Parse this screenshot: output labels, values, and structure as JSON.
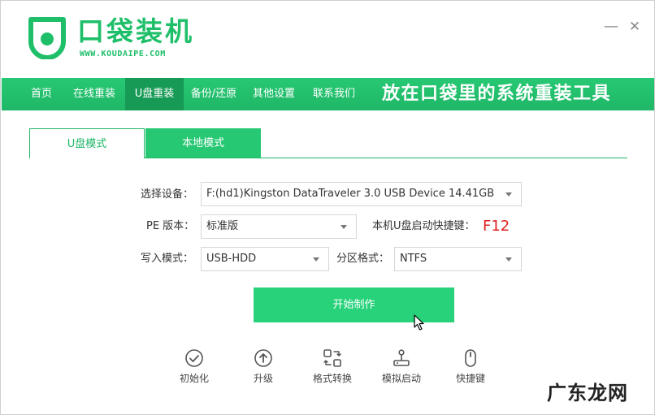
{
  "app": {
    "title": "口袋装机",
    "url": "WWW.KOUDAIPE.COM",
    "minimize_glyph": "—",
    "close_glyph": "✕",
    "brand_color": "#1fbf6a"
  },
  "nav": {
    "items": [
      {
        "label": "首页"
      },
      {
        "label": "在线重装"
      },
      {
        "label": "U盘重装",
        "active": true
      },
      {
        "label": "备份/还原"
      },
      {
        "label": "其他设置"
      },
      {
        "label": "联系我们"
      }
    ],
    "slogan": "放在口袋里的系统重装工具"
  },
  "tabs": [
    {
      "label": "U盘模式",
      "selected": true
    },
    {
      "label": "本地模式",
      "selected": false
    }
  ],
  "form": {
    "device_label": "选择设备：",
    "device_value": "F:(hd1)Kingston DataTraveler 3.0 USB Device 14.41GB",
    "pe_label": "PE 版本：",
    "pe_value": "标准版",
    "hotkey_label": "本机U盘启动快捷键：",
    "hotkey_value": "F12",
    "write_label": "写入模式：",
    "write_value": "USB-HDD",
    "partition_label": "分区格式：",
    "partition_value": "NTFS"
  },
  "start_button": "开始制作",
  "tools": [
    {
      "label": "初始化",
      "icon": "check-circle-icon"
    },
    {
      "label": "升级",
      "icon": "upload-circle-icon"
    },
    {
      "label": "格式转换",
      "icon": "convert-icon"
    },
    {
      "label": "模拟启动",
      "icon": "joystick-icon"
    },
    {
      "label": "快捷键",
      "icon": "mouse-icon"
    }
  ],
  "watermark": "广东龙网",
  "colors": {
    "accent": "#27c873",
    "accent_dark": "#169a55",
    "hotkey": "#e02020",
    "start_button": "#27d27a"
  }
}
